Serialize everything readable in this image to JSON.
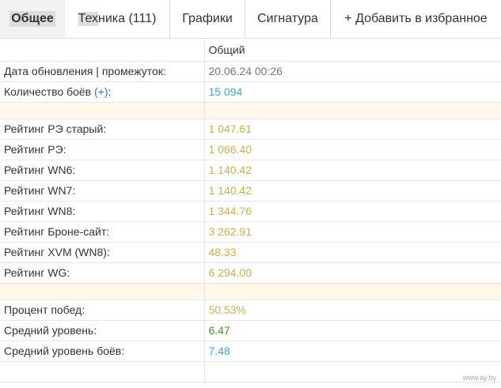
{
  "tabs": {
    "general": "Общее",
    "tech_prefix": "Тех",
    "tech_rest": "ника (111)",
    "charts": "Графики",
    "signature": "Сигнатура",
    "favorite": "+ Добавить в избранное"
  },
  "table": {
    "column_header": "Общий",
    "update_label": "Дата обновления | промежуток:",
    "update_value": "20.06.24 00:26",
    "battles_label": "Количество боёв",
    "battles_plus": "(+)",
    "battles_label_end": ":",
    "battles_value": "15 094",
    "ratings": [
      {
        "label": "Рейтинг РЭ старый:",
        "value": "1 047.61"
      },
      {
        "label": "Рейтинг РЭ:",
        "value": "1 066.40"
      },
      {
        "label": "Рейтинг WN6:",
        "value": "1 140.42"
      },
      {
        "label": "Рейтинг WN7:",
        "value": "1 140.42"
      },
      {
        "label": "Рейтинг WN8:",
        "value": "1 344.76"
      },
      {
        "label": "Рейтинг Броне-сайт:",
        "value": "3 262.91"
      },
      {
        "label": "Рейтинг XVM (WN8):",
        "value": "48.33"
      },
      {
        "label": "Рейтинг WG:",
        "value": "6 294.00"
      }
    ],
    "wins_label": "Процент побед:",
    "wins_value": "50.53%",
    "avg_level_label": "Средний уровень:",
    "avg_level_value": "6.47",
    "avg_battle_level_label": "Средний уровень боёв:",
    "avg_battle_level_value": "7.48"
  },
  "colors": {
    "blue": "#3aa9d6",
    "gold": "#c9b24a",
    "green": "#3c9a2b",
    "spacer": "#fdf8e8"
  },
  "watermark": "www.ay.by"
}
